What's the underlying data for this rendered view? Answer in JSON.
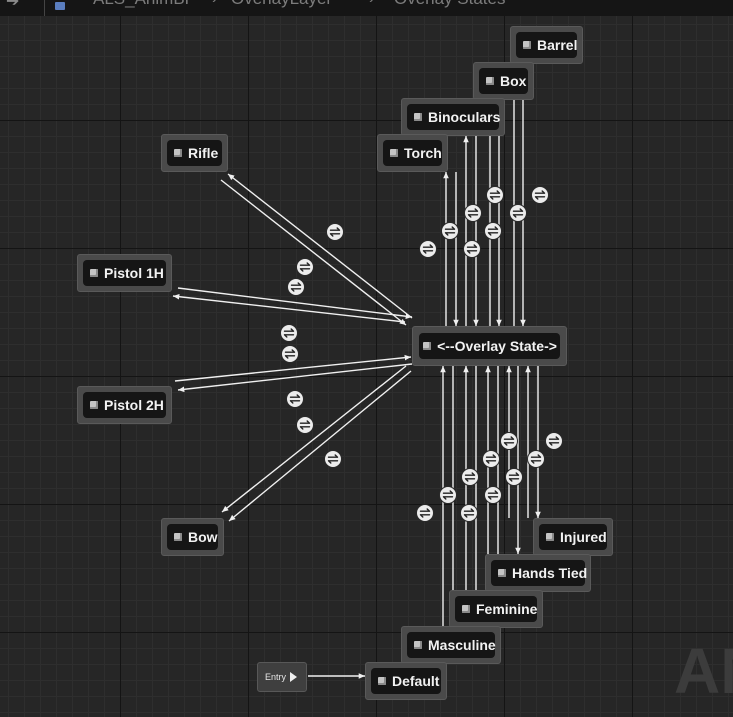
{
  "breadcrumb": {
    "asset": "ALS_AnimBP",
    "layer": "OverlayLayer",
    "machine": "Overlay States"
  },
  "colors": {
    "background": "#262626",
    "node_frame": "#4a4a4a",
    "node_body": "#151515",
    "transition_lines": "#f0f0f0"
  },
  "entry": {
    "label": "Entry",
    "icon": "play-icon"
  },
  "watermark": "AN",
  "conduit": {
    "label": "<--Overlay State->"
  },
  "states": {
    "default": "Default",
    "barrel": "Barrel",
    "box": "Box",
    "binoculars": "Binoculars",
    "torch": "Torch",
    "rifle": "Rifle",
    "pistol_1h": "Pistol 1H",
    "pistol_2h": "Pistol 2H",
    "bow": "Bow",
    "injured": "Injured",
    "hands_tied": "Hands Tied",
    "feminine": "Feminine",
    "masculine": "Masculine"
  }
}
